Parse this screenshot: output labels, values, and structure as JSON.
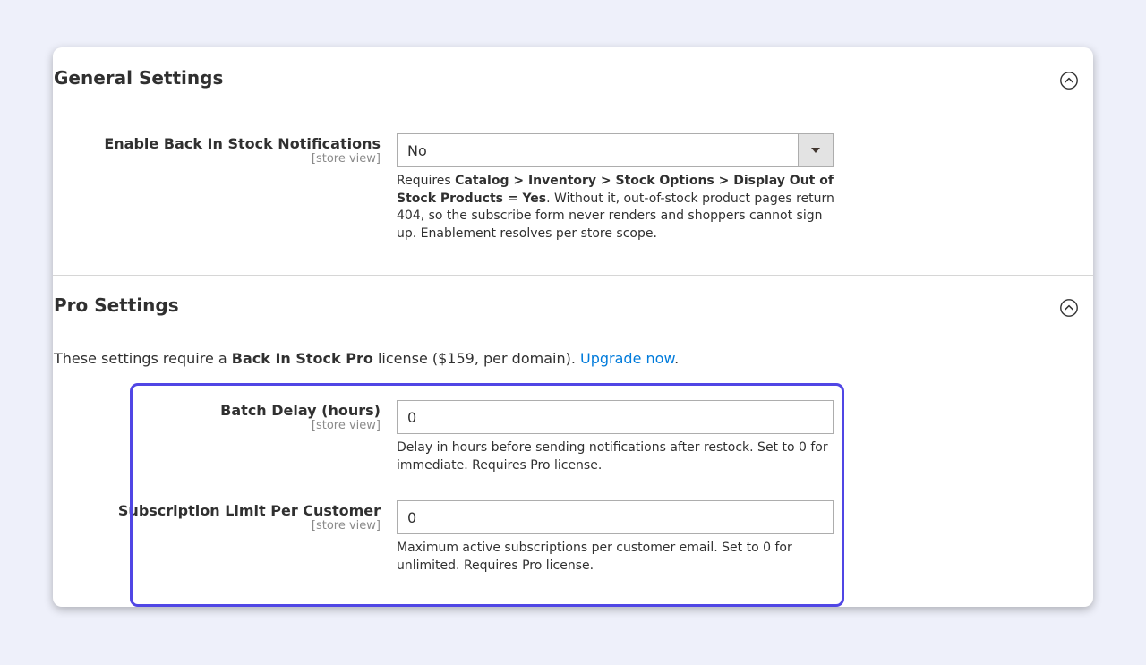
{
  "general": {
    "title": "General Settings",
    "collapse_icon": "chevron-up-circle-icon",
    "enable": {
      "label": "Enable Back In Stock Notifications",
      "scope": "[store view]",
      "value": "No",
      "options": [
        "No"
      ],
      "note_prefix": "Requires ",
      "note_bold": "Catalog > Inventory > Stock Options > Display Out of Stock Products = Yes",
      "note_suffix": ". Without it, out-of-stock product pages return 404, so the subscribe form never renders and shoppers cannot sign up. Enablement resolves per store scope."
    }
  },
  "pro": {
    "title": "Pro Settings",
    "collapse_icon": "chevron-up-circle-icon",
    "intro_prefix": "These settings require a ",
    "intro_bold": "Back In Stock Pro",
    "intro_middle": " license ($159, per domain). ",
    "intro_link": "Upgrade now",
    "intro_suffix": ".",
    "batch_delay": {
      "label": "Batch Delay (hours)",
      "scope": "[store view]",
      "value": "0",
      "note": "Delay in hours before sending notifications after restock. Set to 0 for immediate. Requires Pro license."
    },
    "subscription_limit": {
      "label": "Subscription Limit Per Customer",
      "scope": "[store view]",
      "value": "0",
      "note": "Maximum active subscriptions per customer email. Set to 0 for unlimited. Requires Pro license."
    }
  },
  "colors": {
    "link": "#007bdb",
    "highlight_border": "#5046e5",
    "background": "#eef0fa"
  }
}
